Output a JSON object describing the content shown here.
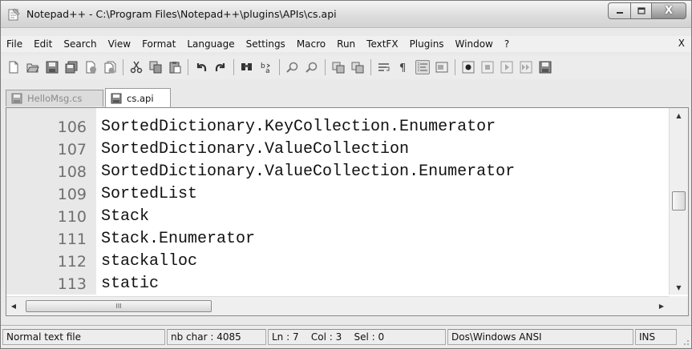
{
  "window": {
    "title": "Notepad++ - C:\\Program Files\\Notepad++\\plugins\\APIs\\cs.api",
    "icon": "notepadpp-app-icon",
    "caption_close_label": "X"
  },
  "menu": {
    "items": [
      "File",
      "Edit",
      "Search",
      "View",
      "Format",
      "Language",
      "Settings",
      "Macro",
      "Run",
      "TextFX",
      "Plugins",
      "Window",
      "?"
    ],
    "close_label": "X"
  },
  "toolbar": {
    "icons": [
      "new-file-icon",
      "open-file-icon",
      "save-icon",
      "save-all-icon",
      "close-icon",
      "close-all-icon",
      "cut-icon",
      "copy-icon",
      "paste-icon",
      "undo-icon",
      "redo-icon",
      "find-icon",
      "replace-icon",
      "zoom-in-icon",
      "zoom-out-icon",
      "sync-vertical-icon",
      "sync-horizontal-icon",
      "word-wrap-icon",
      "show-all-chars-icon",
      "indent-guide-icon",
      "user-lang-icon",
      "record-macro-icon",
      "stop-macro-icon",
      "play-macro-icon",
      "run-macro-multiple-icon",
      "save-macro-icon"
    ]
  },
  "tabs": [
    {
      "label": "HelloMsg.cs",
      "active": false
    },
    {
      "label": "cs.api",
      "active": true
    }
  ],
  "editor": {
    "lines": [
      {
        "num": "106",
        "text": "SortedDictionary.KeyCollection.Enumerator"
      },
      {
        "num": "107",
        "text": "SortedDictionary.ValueCollection"
      },
      {
        "num": "108",
        "text": "SortedDictionary.ValueCollection.Enumerator"
      },
      {
        "num": "109",
        "text": "SortedList"
      },
      {
        "num": "110",
        "text": "Stack"
      },
      {
        "num": "111",
        "text": "Stack.Enumerator"
      },
      {
        "num": "112",
        "text": "stackalloc"
      },
      {
        "num": "113",
        "text": "static"
      }
    ],
    "hscroll_thumb_label": "III"
  },
  "status": {
    "file_type": "Normal text file",
    "nb_char": "nb char : 4085",
    "position": "Ln : 7    Col : 3    Sel : 0",
    "eol_encoding": "Dos\\Windows ANSI",
    "mode": "INS"
  },
  "colors": {
    "gutter": "#e8e8e8",
    "line_number": "#6f6f6f",
    "editor_bg": "#ffffff"
  }
}
